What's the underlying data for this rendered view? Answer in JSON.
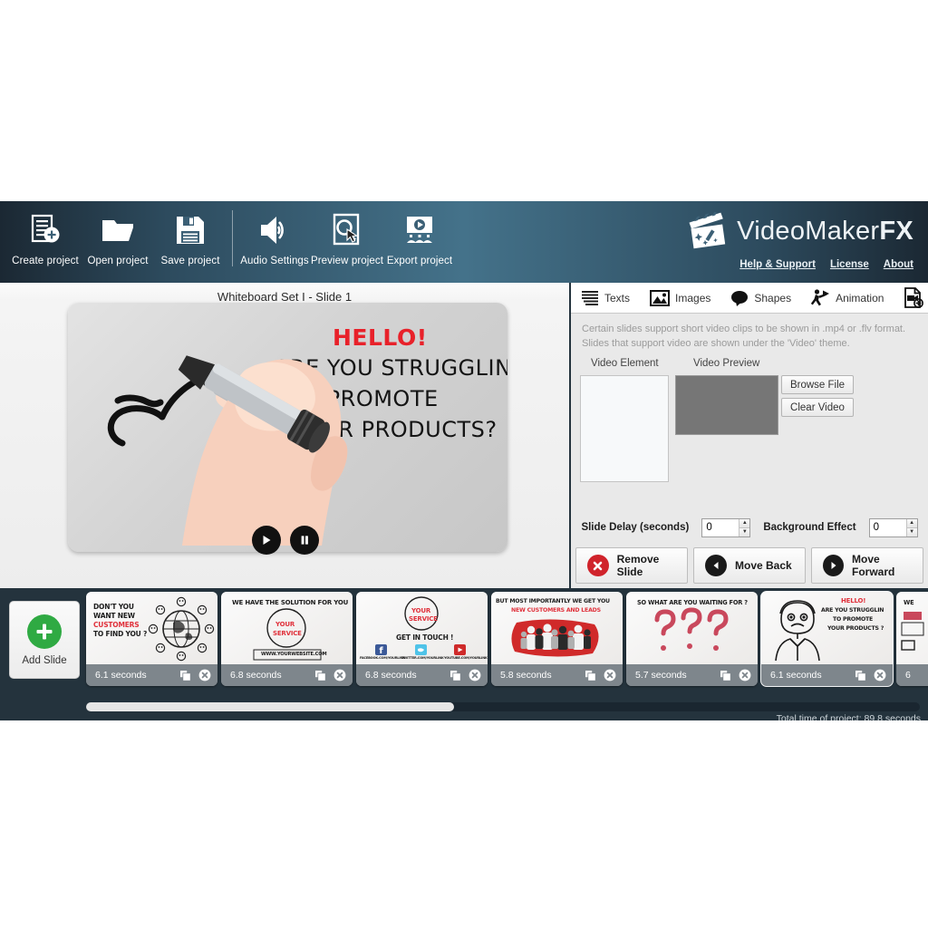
{
  "header": {
    "tools": [
      {
        "label": "Create project",
        "icon": "create-project-icon"
      },
      {
        "label": "Open project",
        "icon": "open-folder-icon"
      },
      {
        "label": "Save project",
        "icon": "save-disk-icon"
      },
      {
        "label": "Audio Settings",
        "icon": "speaker-icon"
      },
      {
        "label": "Preview project",
        "icon": "magnifier-preview-icon"
      },
      {
        "label": "Export project",
        "icon": "export-presentation-icon"
      }
    ],
    "brand_light": "VideoMaker",
    "brand_bold": "FX",
    "links": [
      {
        "label": "Help & Support"
      },
      {
        "label": "License"
      },
      {
        "label": "About"
      }
    ],
    "accent_bg": "#44728a",
    "accent_dark": "#1b2833"
  },
  "preview": {
    "slide_title": "Whiteboard Set I - Slide  1",
    "whiteboard": {
      "hello": "HELLO!",
      "line1": "ARE YOU STRUGGLING",
      "line2": "TO PROMOTE",
      "line3": "YOUR PRODUCTS?",
      "hello_color": "#e8212a"
    },
    "play_label": "play-button",
    "pause_label": "pause-button"
  },
  "panel": {
    "tabs": [
      {
        "label": "Texts",
        "icon": "text-lines-icon"
      },
      {
        "label": "Images",
        "icon": "image-frame-icon"
      },
      {
        "label": "Shapes",
        "icon": "speech-bubble-icon"
      },
      {
        "label": "Animation",
        "icon": "running-person-icon"
      }
    ],
    "add_video_icon": "add-video-icon",
    "help_line1": "Certain slides support short video clips to be shown in .mp4 or .flv format.",
    "help_line2": "Slides that support video are shown under the 'Video' theme.",
    "video_element_label": "Video Element",
    "video_preview_label": "Video Preview",
    "browse_label": "Browse File",
    "clear_label": "Clear Video",
    "slide_delay_label": "Slide Delay (seconds)",
    "slide_delay_value": "0",
    "background_effect_label": "Background Effect",
    "background_effect_value": "0",
    "remove_slide_label": "Remove Slide",
    "move_back_label": "Move Back",
    "move_forward_label": "Move Forward",
    "remove_color": "#d0232b"
  },
  "filmstrip": {
    "add_slide_label": "Add Slide",
    "add_slide_color": "#2faa43",
    "slides": [
      {
        "duration": "6.1 seconds",
        "selected": false,
        "art": "customers-globe",
        "lines": [
          "DON'T YOU",
          "WANT NEW",
          "CUSTOMERS",
          "TO FIND YOU ?"
        ]
      },
      {
        "duration": "6.8 seconds",
        "selected": false,
        "art": "solution-circle",
        "lines": [
          "WE HAVE THE SOLUTION FOR YOU",
          "YOUR",
          "SERVICE",
          "WWW.YOURWEBSITE.COM"
        ]
      },
      {
        "duration": "6.8 seconds",
        "selected": false,
        "art": "get-in-touch",
        "lines": [
          "YOUR",
          "SERVICE",
          "GET IN TOUCH !",
          "FACEBOOK.COM/YOURLINK",
          "TWITTER.COM/YOURLINK",
          "YOUTUBE.COM/YOURLINK"
        ]
      },
      {
        "duration": "5.8 seconds",
        "selected": false,
        "art": "crowd-red",
        "lines": [
          "BUT MOST IMPORTANTLY WE GET YOU",
          "NEW CUSTOMERS AND LEADS"
        ]
      },
      {
        "duration": "5.7 seconds",
        "selected": false,
        "art": "question-marks",
        "lines": [
          "SO WHAT ARE YOU WAITING FOR ?"
        ]
      },
      {
        "duration": "6.1 seconds",
        "selected": true,
        "art": "sad-man",
        "lines": [
          "HELLO!",
          "ARE YOU STRUGGLIN",
          "TO PROMOTE",
          "YOUR PRODUCTS ?"
        ]
      },
      {
        "duration": "6",
        "selected": false,
        "art": "partial",
        "lines": [
          "WE"
        ]
      }
    ],
    "total_time": "Total time of project: 89.8 seconds"
  }
}
